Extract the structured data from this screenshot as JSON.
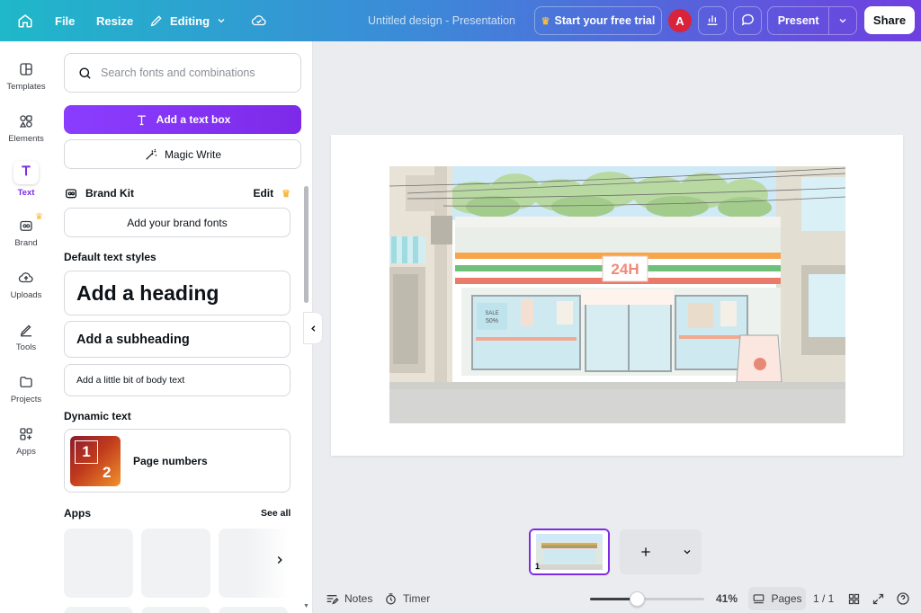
{
  "topbar": {
    "file": "File",
    "resize": "Resize",
    "editing": "Editing",
    "title": "Untitled design - Presentation",
    "trial": "Start your free trial",
    "avatar": "A",
    "present": "Present",
    "share": "Share",
    "gradient_start": "#1fb8c9",
    "gradient_end": "#6f3fe0"
  },
  "rail": {
    "items": [
      {
        "label": "Templates",
        "icon": "templates-icon"
      },
      {
        "label": "Elements",
        "icon": "elements-icon"
      },
      {
        "label": "Text",
        "icon": "text-icon"
      },
      {
        "label": "Brand",
        "icon": "brand-icon"
      },
      {
        "label": "Uploads",
        "icon": "uploads-icon"
      },
      {
        "label": "Tools",
        "icon": "tools-icon"
      },
      {
        "label": "Projects",
        "icon": "folder-icon"
      },
      {
        "label": "Apps",
        "icon": "apps-icon"
      }
    ],
    "active": "Text"
  },
  "panel": {
    "search_placeholder": "Search fonts and combinations",
    "add_text_box": "Add a text box",
    "magic_write": "Magic Write",
    "brand_kit": "Brand Kit",
    "brand_edit": "Edit",
    "add_brand_fonts": "Add your brand fonts",
    "default_styles": "Default text styles",
    "heading": "Add a heading",
    "subheading": "Add a subheading",
    "body": "Add a little bit of body text",
    "dynamic_text": "Dynamic text",
    "page_numbers": "Page numbers",
    "apps": "Apps",
    "see_all": "See all",
    "accent": "#7d2ae8"
  },
  "canvas": {
    "sign": "24H",
    "sale": "SALE",
    "sale_pct": "50%",
    "page_number": "1"
  },
  "bottom": {
    "notes": "Notes",
    "timer": "Timer",
    "zoom": "41%",
    "zoom_level": 0.41,
    "pages": "Pages",
    "page_count": "1 / 1"
  }
}
